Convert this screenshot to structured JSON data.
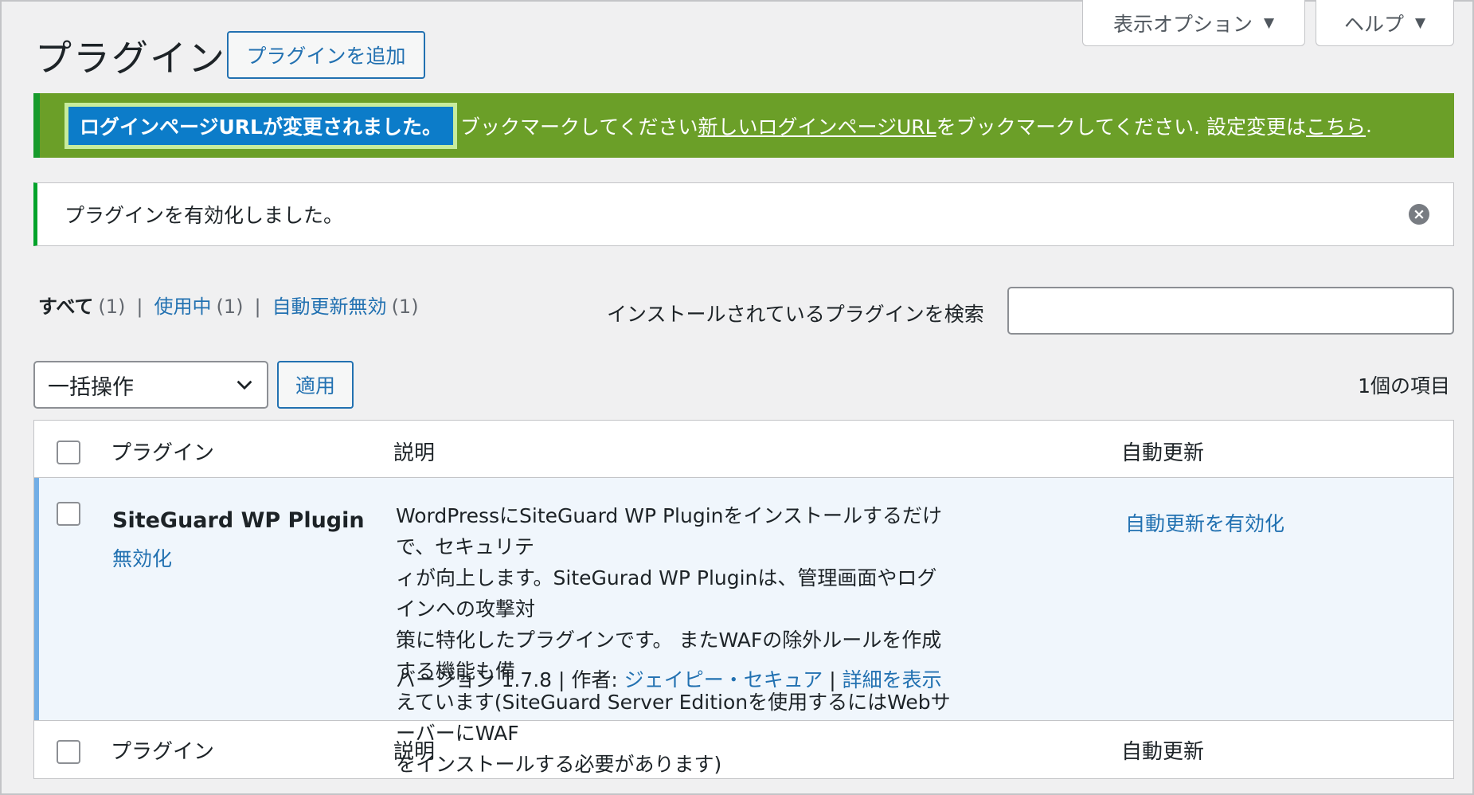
{
  "screen_meta": {
    "display_options": "表示オプション",
    "help": "ヘルプ"
  },
  "page": {
    "title": "プラグイン",
    "add_new": "プラグインを追加"
  },
  "login_notice": {
    "highlight": "ログインページURLが変更されました。",
    "text_1": "ブックマークしてください",
    "link_1": "新しいログインページURL",
    "text_2": "をブックマークしてください. 設定変更は",
    "link_2": "こちら",
    "text_3": "."
  },
  "activated_notice": {
    "text": "プラグインを有効化しました。"
  },
  "filters": {
    "all": {
      "label": "すべて",
      "count": "(1)"
    },
    "active": {
      "label": "使用中",
      "count": "(1)"
    },
    "auto_disabled": {
      "label": "自動更新無効",
      "count": "(1)"
    },
    "sep": "|"
  },
  "search": {
    "label": "インストールされているプラグインを検索",
    "value": ""
  },
  "bulk": {
    "selected": "一括操作",
    "apply": "適用"
  },
  "items_count": "1個の項目",
  "table": {
    "headers": {
      "plugin": "プラグイン",
      "description": "説明",
      "auto_update": "自動更新"
    },
    "rows": [
      {
        "name": "SiteGuard WP Plugin",
        "deactivate": "無効化",
        "description_lines": [
          "WordPressにSiteGuard WP Pluginをインストールするだけで、セキュリテ",
          "ィが向上します。SiteGurad WP Pluginは、管理画面やログインへの攻撃対",
          "策に特化したプラグインです。 またWAFの除外ルールを作成する機能も備",
          "えています(SiteGuard Server Editionを使用するにはWebサーバーにWAF",
          "をインストールする必要があります)"
        ],
        "version_label": "バージョン 1.7.8 | 作者: ",
        "author": "ジェイピー・セキュア",
        "sep": " | ",
        "details": "詳細を表示",
        "auto_update": "自動更新を有効化"
      }
    ]
  },
  "colors": {
    "accent": "#2271b1",
    "notice_green": "#6b9f28",
    "highlight_blue": "#0c7cc9",
    "active_row": "#f0f6fc"
  }
}
